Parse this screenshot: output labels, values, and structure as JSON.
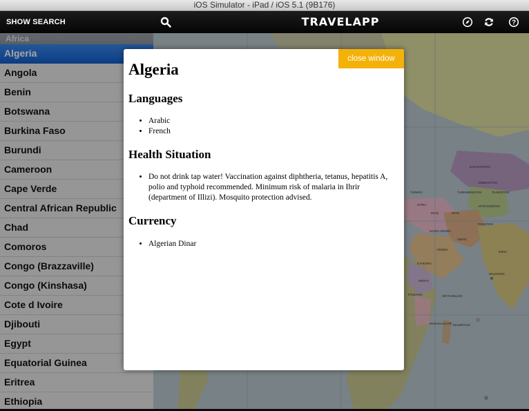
{
  "window": {
    "title": "iOS Simulator - iPad / iOS 5.1 (9B176)"
  },
  "navbar": {
    "search_label": "SHOW SEARCH",
    "app_title": "TRAVELAPP",
    "icons": [
      "search-icon",
      "compass-icon",
      "refresh-icon",
      "help-icon"
    ]
  },
  "sidebar": {
    "section": "Africa",
    "countries": [
      "Algeria",
      "Angola",
      "Benin",
      "Botswana",
      "Burkina Faso",
      "Burundi",
      "Cameroon",
      "Cape Verde",
      "Central African Republic",
      "Chad",
      "Comoros",
      "Congo (Brazzaville)",
      "Congo (Kinshasa)",
      "Cote d Ivoire",
      "Djibouti",
      "Egypt",
      "Equatorial Guinea",
      "Eritrea",
      "Ethiopia"
    ],
    "selected": "Algeria"
  },
  "modal": {
    "close_label": "close window",
    "country": "Algeria",
    "languages_heading": "Languages",
    "languages": [
      "Arabic",
      "French"
    ],
    "health_heading": "Health Situation",
    "health": [
      "Do not drink tap water! Vaccination against diphtheria, tetanus, hepatitis A, polio and typhoid recommended. Minimum risk of malaria in Ihrir (department of Illizi). Mosquito protection advised."
    ],
    "currency_heading": "Currency",
    "currency": [
      "Algerian Dinar"
    ]
  },
  "map_labels": [
    "KAZAKHSTAN",
    "UZBEKISTAN",
    "TURKMENISTAN",
    "TAJIKISTAN",
    "AFGHANISTAN",
    "TURKEY",
    "SYRIA",
    "IRAQ",
    "IRAN",
    "PAKISTAN",
    "SAUDI ARABIA",
    "YEMEN",
    "OMAN",
    "ETHIOPIA",
    "KENYA",
    "TANZANIA",
    "SEYCHELLES",
    "MADAGASCAR",
    "MAURITIUS",
    "MALDIVES",
    "INDIA"
  ],
  "colors": {
    "accent": "#f3b20a",
    "selected_row": "#2a78e0",
    "navbar": "#111111"
  }
}
